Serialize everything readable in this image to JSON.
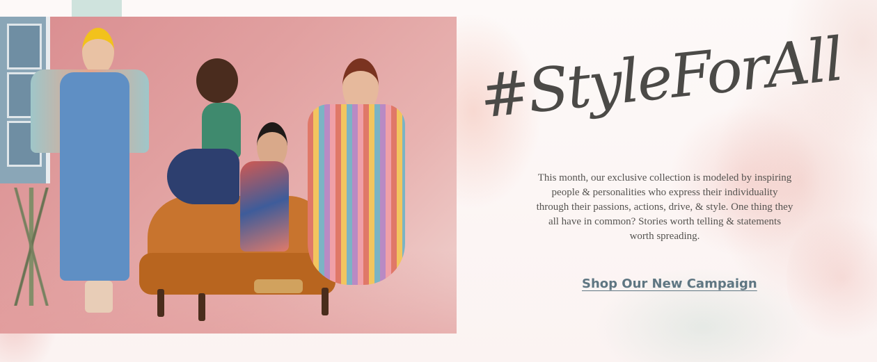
{
  "hero": {
    "image_alt": "Four women in colorful dresses posing around an orange velvet sofa against a pink backdrop",
    "headline": "#StyleForAll",
    "description": "This month, our exclusive collection is modeled by inspiring people & personalities who express their individuality through their passions, actions, drive, & style. One thing they all have in common? Stories worth telling & statements worth spreading.",
    "cta_label": "Shop Our New Campaign"
  },
  "colors": {
    "headline": "#4b4a47",
    "body_text": "#555350",
    "cta": "#5f7682",
    "backdrop_pink": "#e1a0a0",
    "sofa": "#c8742e"
  }
}
